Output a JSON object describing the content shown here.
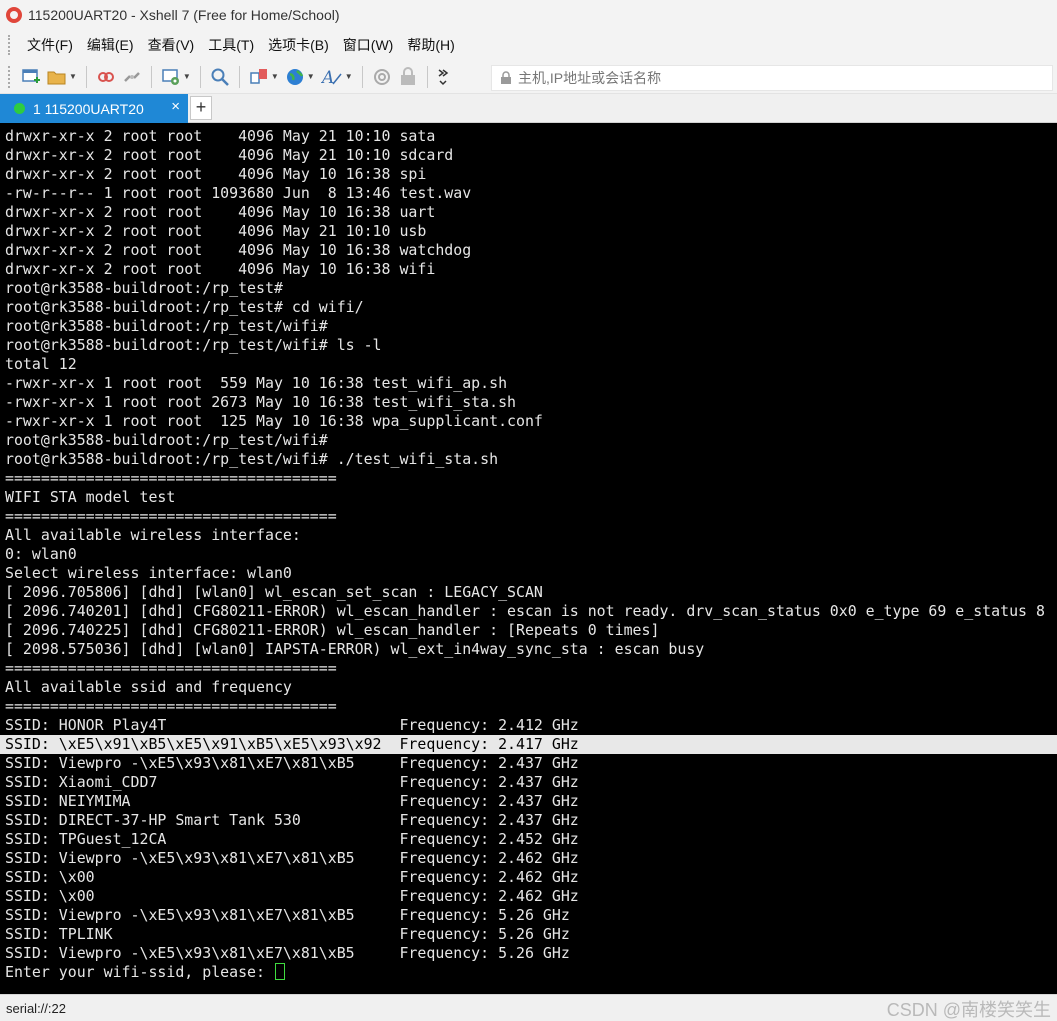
{
  "window": {
    "title": "115200UART20 - Xshell 7 (Free for Home/School)"
  },
  "menu": [
    "文件(F)",
    "编辑(E)",
    "查看(V)",
    "工具(T)",
    "选项卡(B)",
    "窗口(W)",
    "帮助(H)"
  ],
  "toolbar": {
    "address_placeholder": "主机,IP地址或会话名称"
  },
  "tab": {
    "label": "1 115200UART20",
    "close": "×",
    "add": "+"
  },
  "terminal": {
    "lines": [
      "drwxr-xr-x 2 root root    4096 May 21 10:10 sata",
      "drwxr-xr-x 2 root root    4096 May 21 10:10 sdcard",
      "drwxr-xr-x 2 root root    4096 May 10 16:38 spi",
      "-rw-r--r-- 1 root root 1093680 Jun  8 13:46 test.wav",
      "drwxr-xr-x 2 root root    4096 May 10 16:38 uart",
      "drwxr-xr-x 2 root root    4096 May 21 10:10 usb",
      "drwxr-xr-x 2 root root    4096 May 10 16:38 watchdog",
      "drwxr-xr-x 2 root root    4096 May 10 16:38 wifi",
      "root@rk3588-buildroot:/rp_test#",
      "root@rk3588-buildroot:/rp_test# cd wifi/",
      "root@rk3588-buildroot:/rp_test/wifi#",
      "root@rk3588-buildroot:/rp_test/wifi# ls -l",
      "total 12",
      "-rwxr-xr-x 1 root root  559 May 10 16:38 test_wifi_ap.sh",
      "-rwxr-xr-x 1 root root 2673 May 10 16:38 test_wifi_sta.sh",
      "-rwxr-xr-x 1 root root  125 May 10 16:38 wpa_supplicant.conf",
      "root@rk3588-buildroot:/rp_test/wifi#",
      "root@rk3588-buildroot:/rp_test/wifi# ./test_wifi_sta.sh",
      "=====================================",
      "WIFI STA model test",
      "=====================================",
      "All available wireless interface:",
      "0: wlan0",
      "Select wireless interface: wlan0",
      "[ 2096.705806] [dhd] [wlan0] wl_escan_set_scan : LEGACY_SCAN",
      "[ 2096.740201] [dhd] CFG80211-ERROR) wl_escan_handler : escan is not ready. drv_scan_status 0x0 e_type 69 e_status 8",
      "[ 2096.740225] [dhd] CFG80211-ERROR) wl_escan_handler : [Repeats 0 times]",
      "[ 2098.575036] [dhd] [wlan0] IAPSTA-ERROR) wl_ext_in4way_sync_sta : escan busy",
      "=====================================",
      "All available ssid and frequency",
      "=====================================",
      "SSID: HONOR Play4T                          Frequency: 2.412 GHz",
      "SSID: \\xE5\\x91\\xB5\\xE5\\x91\\xB5\\xE5\\x93\\x92  Frequency: 2.417 GHz",
      "SSID: Viewpro -\\xE5\\x93\\x81\\xE7\\x81\\xB5     Frequency: 2.437 GHz",
      "SSID: Xiaomi_CDD7                           Frequency: 2.437 GHz",
      "SSID: NEIYMIMA                              Frequency: 2.437 GHz",
      "SSID: DIRECT-37-HP Smart Tank 530           Frequency: 2.437 GHz",
      "SSID: TPGuest_12CA                          Frequency: 2.452 GHz",
      "SSID: Viewpro -\\xE5\\x93\\x81\\xE7\\x81\\xB5     Frequency: 2.462 GHz",
      "SSID: \\x00                                  Frequency: 2.462 GHz",
      "SSID: \\x00                                  Frequency: 2.462 GHz",
      "SSID: Viewpro -\\xE5\\x93\\x81\\xE7\\x81\\xB5     Frequency: 5.26 GHz",
      "SSID: TPLINK                                Frequency: 5.26 GHz",
      "SSID: Viewpro -\\xE5\\x93\\x81\\xE7\\x81\\xB5     Frequency: 5.26 GHz",
      "Enter your wifi-ssid, please: "
    ],
    "highlighted_line": 32
  },
  "status": {
    "text": "serial://:22"
  },
  "watermark": "CSDN @南楼笑笑生",
  "colors": {
    "tab_active": "#1f88d6",
    "terminal_bg": "#000000",
    "cursor": "#3fdc3f"
  }
}
